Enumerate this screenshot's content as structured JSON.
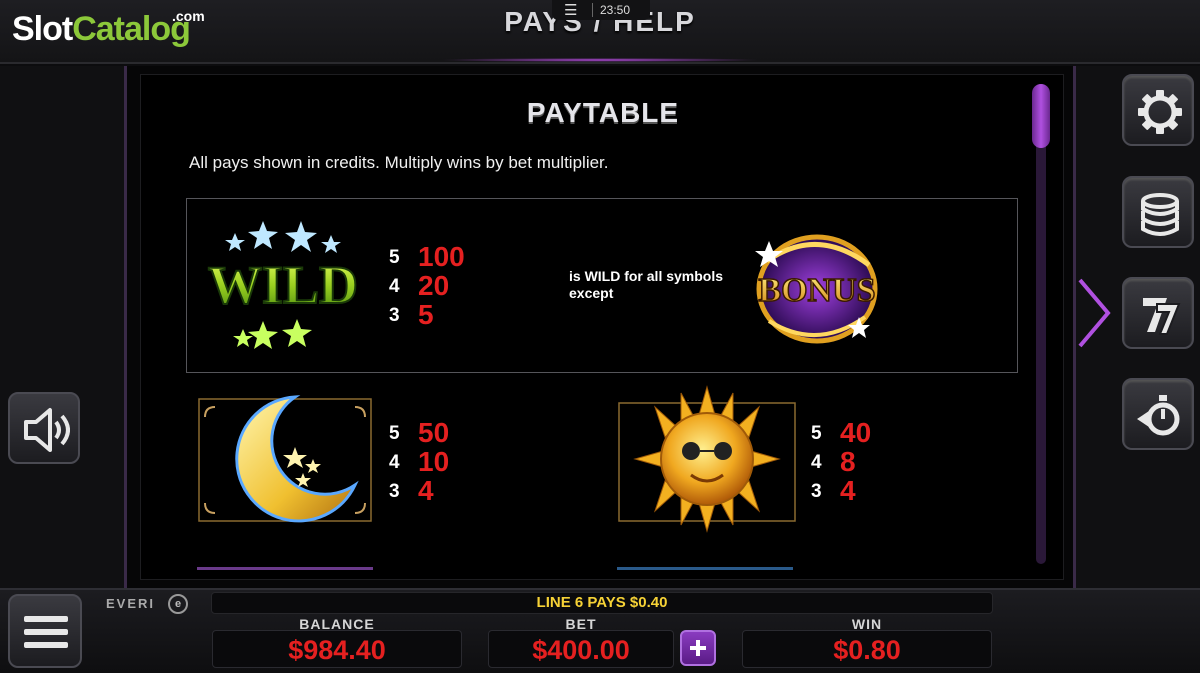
{
  "logo": {
    "slot": "Slot",
    "catalog": "Catalog",
    "com": ".com"
  },
  "header": {
    "title": "PAYS / HELP",
    "clock": "23:50"
  },
  "paytable": {
    "title": "PAYTABLE",
    "note": "All pays shown in credits. Multiply wins by bet multiplier.",
    "wild": {
      "symbol_text": "WILD",
      "pays": [
        {
          "count": "5",
          "value": "100"
        },
        {
          "count": "4",
          "value": "20"
        },
        {
          "count": "3",
          "value": "5"
        }
      ],
      "description": "is WILD for all symbols except",
      "exception_symbol": "BONUS"
    },
    "moon": {
      "pays": [
        {
          "count": "5",
          "value": "50"
        },
        {
          "count": "4",
          "value": "10"
        },
        {
          "count": "3",
          "value": "4"
        }
      ]
    },
    "sun": {
      "pays": [
        {
          "count": "5",
          "value": "40"
        },
        {
          "count": "4",
          "value": "8"
        },
        {
          "count": "3",
          "value": "4"
        }
      ]
    }
  },
  "side_buttons": [
    "gear-icon",
    "coin-stack-icon",
    "sevens-icon",
    "autoplay-icon"
  ],
  "bottom": {
    "brand": "EVERI",
    "message": "LINE 6 PAYS $0.40",
    "balance_label": "BALANCE",
    "balance_value": "$984.40",
    "bet_label": "BET",
    "bet_value": "$400.00",
    "win_label": "WIN",
    "win_value": "$0.80"
  },
  "colors": {
    "accent": "#8a3cc0",
    "pay_value": "#e52020",
    "message": "#f6d236",
    "logo_green": "#8cc83a"
  }
}
